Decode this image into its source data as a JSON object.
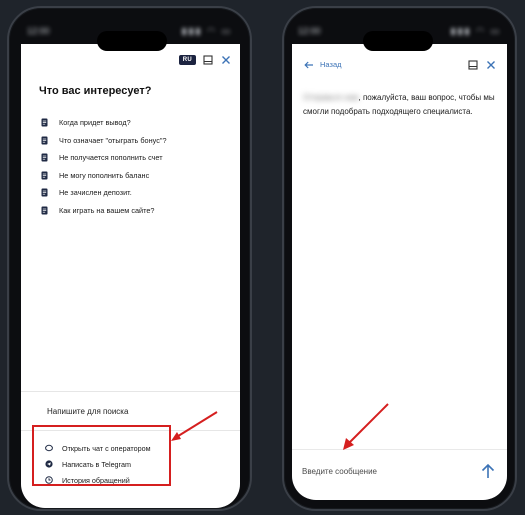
{
  "left_phone": {
    "language": "RU",
    "title": "Что вас интересует?",
    "faq_items": [
      "Когда придет вывод?",
      "Что означает \"отыграть бонус\"?",
      "Не получается пополнить счет",
      "Не могу пополнить баланс",
      "Не зачислен депозит.",
      "Как играть на вашем сайте?"
    ],
    "search_label": "Напишите для поиска",
    "actions": [
      {
        "label": "Открыть чат с оператором",
        "icon": "chat-bubble-icon"
      },
      {
        "label": "Написать в Telegram",
        "icon": "telegram-icon"
      },
      {
        "label": "История обращений",
        "icon": "clock-icon"
      }
    ]
  },
  "right_phone": {
    "back_label": "Назад",
    "message_blurred": "Отправьте нам",
    "message_text": ", пожалуйста, ваш вопрос, чтобы мы смогли подобрать подходящего специалиста.",
    "input_placeholder": "Введите сообщение"
  },
  "colors": {
    "accent_blue": "#3c73b6",
    "highlight_red": "#d51f1f",
    "lang_badge": "#1c2340"
  }
}
